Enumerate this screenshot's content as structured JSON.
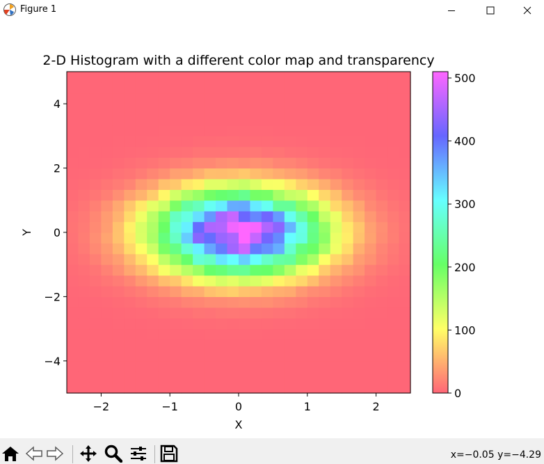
{
  "window": {
    "title": "Figure 1"
  },
  "status": {
    "coords": "x=−0.05 y=−4.29"
  },
  "toolbar": {
    "icons": [
      "home-icon",
      "back-icon",
      "forward-icon",
      "pan-icon",
      "zoom-icon",
      "configure-subplots-icon",
      "save-icon"
    ]
  },
  "chart_data": {
    "type": "heatmap",
    "title": "2-D Histogram with a different color map and transparency",
    "xlabel": "X",
    "ylabel": "Y",
    "xlim": [
      -2.5,
      2.5
    ],
    "ylim": [
      -5,
      5
    ],
    "bins_x": 30,
    "bins_y": 30,
    "peak_count": 510,
    "distribution": "bivariate normal, mean (0, 0), sigma x ≈ 0.85, sigma y ≈ 0.9",
    "x_ticks": [
      -2,
      -1,
      0,
      1,
      2
    ],
    "x_tick_labels": [
      "−2",
      "−1",
      "0",
      "1",
      "2"
    ],
    "y_ticks": [
      4,
      2,
      0,
      -2,
      -4
    ],
    "y_tick_labels": [
      "4",
      "2",
      "0",
      "−2",
      "−4"
    ],
    "colorbar": {
      "colormap": "gist_rainbow (reversed)",
      "alpha": 0.6,
      "range": [
        0,
        510
      ],
      "ticks": [
        0,
        100,
        200,
        300,
        400,
        500
      ],
      "tick_labels": [
        "0",
        "100",
        "200",
        "300",
        "400",
        "500"
      ]
    }
  }
}
